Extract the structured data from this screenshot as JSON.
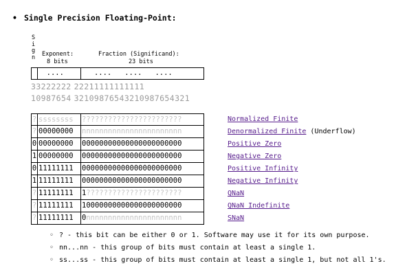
{
  "heading": {
    "bullet": "•",
    "title": "Single Precision Floating-Point:"
  },
  "header": {
    "sign_letters": "S\ni\ng\nn",
    "exponent_label": "Exponent:",
    "exponent_bits": "8 bits",
    "fraction_label": "Fraction (Significand):",
    "fraction_bits": "23 bits"
  },
  "layout_row": {
    "sign": "",
    "exp_dots": "  ....",
    "frac_dots": "   ....   ....   ...."
  },
  "bit_numbers": {
    "tens_exp": "33222222",
    "tens_frac": "22211111111111",
    "ones_exp": "10987654",
    "ones_frac": "32109876543210987654321"
  },
  "rows": [
    {
      "sign": "?",
      "sign_gray": true,
      "exp": "ssssssss",
      "exp_gray": true,
      "frac": "???????????????????????",
      "frac_gray": true,
      "label": "Normalized Finite",
      "note": ""
    },
    {
      "sign": "?",
      "sign_gray": true,
      "exp": "00000000",
      "exp_gray": false,
      "frac": "nnnnnnnnnnnnnnnnnnnnnnn",
      "frac_gray": true,
      "label": "Denormalized Finite",
      "note": "(Underflow)"
    },
    {
      "sign": "0",
      "sign_gray": false,
      "exp": "00000000",
      "exp_gray": false,
      "frac": "00000000000000000000000",
      "frac_gray": false,
      "label": "Positive Zero",
      "note": ""
    },
    {
      "sign": "1",
      "sign_gray": false,
      "exp": "00000000",
      "exp_gray": false,
      "frac": "00000000000000000000000",
      "frac_gray": false,
      "label": "Negative Zero",
      "note": ""
    },
    {
      "sign": "0",
      "sign_gray": false,
      "exp": "11111111",
      "exp_gray": false,
      "frac": "00000000000000000000000",
      "frac_gray": false,
      "label": "Positive Infinity",
      "note": ""
    },
    {
      "sign": "1",
      "sign_gray": false,
      "exp": "11111111",
      "exp_gray": false,
      "frac": "00000000000000000000000",
      "frac_gray": false,
      "label": "Negative Infinity",
      "note": ""
    },
    {
      "sign": "?",
      "sign_gray": true,
      "exp": "11111111",
      "exp_gray": false,
      "frac_head": "1",
      "frac": "??????????????????????",
      "frac_gray": true,
      "label": "QNaN",
      "note": ""
    },
    {
      "sign": "?",
      "sign_gray": true,
      "exp": "11111111",
      "exp_gray": false,
      "frac": "10000000000000000000000",
      "frac_gray": false,
      "label": "QNaN Indefinite",
      "note": ""
    },
    {
      "sign": "?",
      "sign_gray": true,
      "exp": "11111111",
      "exp_gray": false,
      "frac_head": "0",
      "frac": "nnnnnnnnnnnnnnnnnnnnnn",
      "frac_gray": true,
      "label": "SNaN",
      "note": ""
    }
  ],
  "notes": [
    "? - this bit can be either 0 or 1. Software may use it for its own purpose.",
    "nn...nn - this group of bits must contain at least a single 1.",
    "ss...ss - this group of bits must contain at least a single 1, but not all 1's."
  ],
  "note_bullet": "◦",
  "colors": {
    "link": "#551a8b",
    "faded": "#c4c4c4",
    "bit_numbers": "#9a9a9a"
  }
}
